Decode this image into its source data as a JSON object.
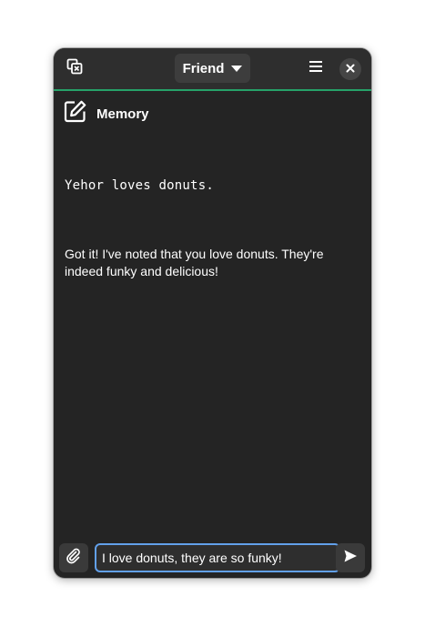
{
  "header": {
    "mode_label": "Friend",
    "left_icon": "window-close-stack-icon",
    "menu_icon": "hamburger-menu-icon",
    "close_icon": "close-icon",
    "accent_color": "#26a269"
  },
  "memory": {
    "icon": "edit-document-icon",
    "label": "Memory"
  },
  "conversation": {
    "user_message": "Yehor loves donuts.",
    "assistant_message": "Got it! I've noted that you love donuts. They're indeed funky and delicious!"
  },
  "composer": {
    "attach_icon": "paperclip-icon",
    "input_value": "I love donuts, they are so funky!",
    "send_icon": "send-icon",
    "focus_color": "#62a0ea"
  }
}
